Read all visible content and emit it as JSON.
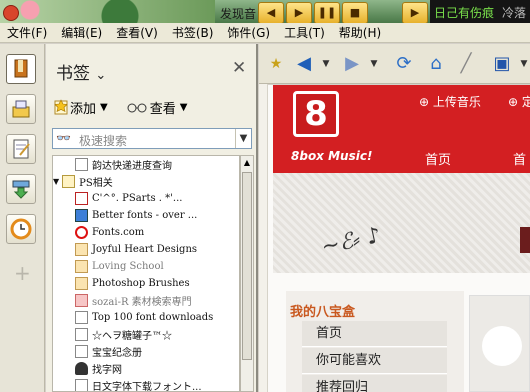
{
  "titlebar": {
    "song_text": "发现音",
    "media_buttons": [
      "◀",
      "▶",
      "❚❚",
      "■",
      "▶"
    ],
    "marquee_text": "日己有伤痕",
    "marquee_tail": "冷落"
  },
  "menu": [
    "文件(F)",
    "编辑(E)",
    "查看(V)",
    "书签(B)",
    "饰件(G)",
    "工具(T)",
    "帮助(H)"
  ],
  "panel": {
    "title": "书签",
    "add_label": "添加",
    "view_label": "查看",
    "search_placeholder": "极速搜索",
    "items": [
      {
        "text": "韵达快递进度查询",
        "style": "normal",
        "icon": "page-icon"
      },
      {
        "text": "PS相关",
        "style": "folder",
        "icon": "folder-icon"
      },
      {
        "text": "C'^°. PSarts . *'...",
        "style": "normal",
        "icon": "psarts-icon"
      },
      {
        "text": "Better fonts - over ...",
        "style": "normal",
        "icon": "bf-icon"
      },
      {
        "text": "Fonts.com",
        "style": "normal",
        "icon": "target-icon"
      },
      {
        "text": "Joyful Heart Designs",
        "style": "normal",
        "icon": "bookmark-icon"
      },
      {
        "text": "Loving School",
        "style": "grey",
        "icon": "bookmark-icon"
      },
      {
        "text": "Photoshop Brushes",
        "style": "normal",
        "icon": "bookmark-icon"
      },
      {
        "text": "sozai-R 素材検索専門",
        "style": "grey",
        "icon": "r-icon"
      },
      {
        "text": "Top 100 font downloads",
        "style": "normal",
        "icon": "page-icon"
      },
      {
        "text": "☆ヘヲ糖罐子™☆",
        "style": "normal",
        "icon": "page-icon"
      },
      {
        "text": "宝宝纪念册",
        "style": "normal",
        "icon": "page-icon"
      },
      {
        "text": "找字网",
        "style": "normal",
        "icon": "figure-icon"
      },
      {
        "text": "日文字体下载フォント...",
        "style": "normal",
        "icon": "page-icon"
      }
    ]
  },
  "site": {
    "logo_digit": "8",
    "brand": "8box Music!",
    "upload_link": "上传音乐",
    "custom_link": "定",
    "nav_home": "首页",
    "nav_second": "首",
    "box_title": "我的八宝盒",
    "box_items": [
      "首页",
      "你可能喜欢",
      "推荐回归"
    ]
  },
  "colors": {
    "site_red": "#d31f22",
    "box_title": "#c9581f",
    "marquee_green": "#79e04b"
  }
}
